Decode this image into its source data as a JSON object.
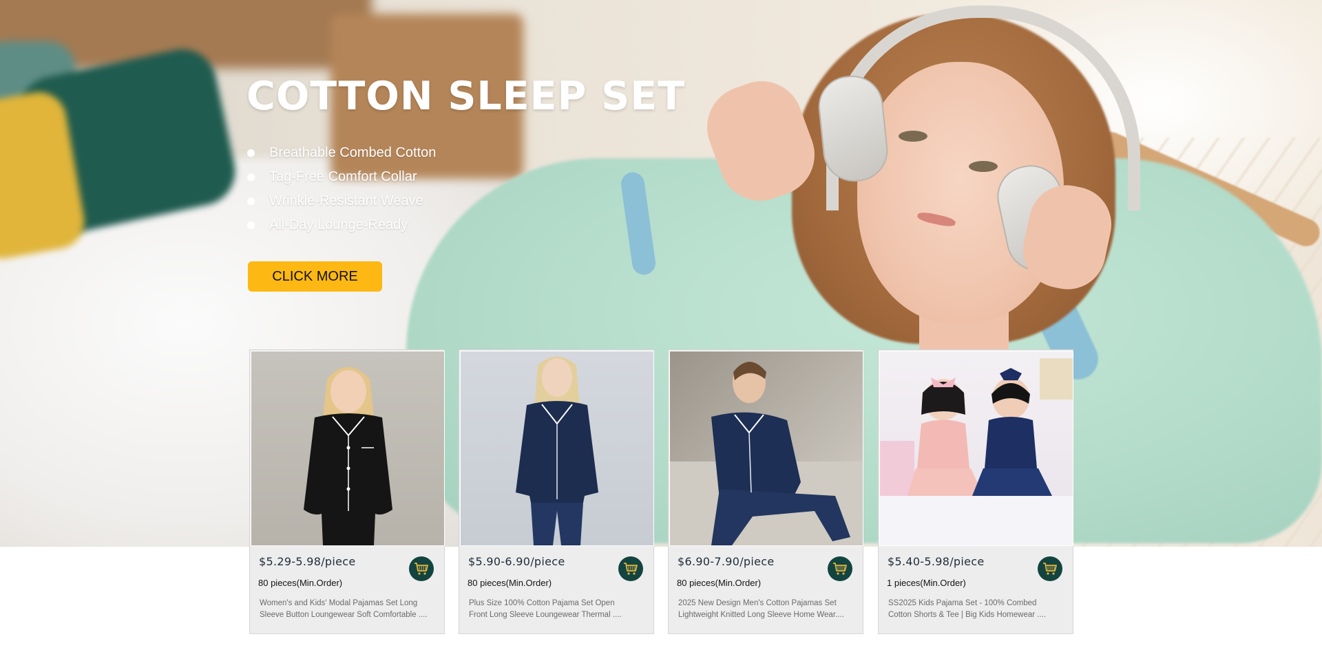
{
  "hero": {
    "title": "COTTON SLEEP SET",
    "features": [
      "Breathable Combed Cotton",
      "Tag-Free Comfort Collar",
      "Wrinkle-Resistant Weave",
      "All-Day Lounge-Ready"
    ],
    "cta_label": "CLICK MORE",
    "colors": {
      "cta": "#fdb813",
      "cart": "#13443f"
    }
  },
  "products": [
    {
      "price": "$5.29-5.98/piece",
      "moq": "80 pieces(Min.Order)",
      "desc_line1": "Women's and Kids' Modal Pajamas Set Long",
      "desc_line2": "Sleeve Button Loungewear Soft Comfortable ...."
    },
    {
      "price": "$5.90-6.90/piece",
      "moq": "80 pieces(Min.Order)",
      "desc_line1": "Plus Size 100% Cotton Pajama Set Open",
      "desc_line2": " Front Long Sleeve Loungewear Thermal ...."
    },
    {
      "price": "$6.90-7.90/piece",
      "moq": "80 pieces(Min.Order)",
      "desc_line1": "2025 New Design Men's Cotton Pajamas Set",
      "desc_line2": "Lightweight Knitted Long Sleeve Home Wear...."
    },
    {
      "price": "$5.40-5.98/piece",
      "moq": "1 pieces(Min.Order)",
      "desc_line1": "SS2025 Kids Pajama Set - 100% Combed",
      "desc_line2": "Cotton Shorts & Tee | Big Kids Homewear ...."
    }
  ],
  "icons": {
    "cart": "shopping-cart-icon",
    "bullet": "bullet-dot-icon"
  }
}
